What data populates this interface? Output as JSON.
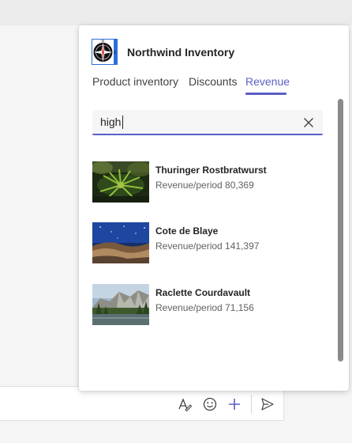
{
  "app": {
    "name": "Northwind Inventory",
    "logo_icon": "compass-logo-icon"
  },
  "tabs": [
    {
      "label": "Product inventory",
      "active": false
    },
    {
      "label": "Discounts",
      "active": false
    },
    {
      "label": "Revenue",
      "active": true
    }
  ],
  "search": {
    "value": "high",
    "clear_icon": "close-icon"
  },
  "results": [
    {
      "title": "Thuringer Rostbratwurst",
      "subtitle": "Revenue/period 80,369",
      "image": "forest-plant-photo"
    },
    {
      "title": "Cote de Blaye",
      "subtitle": "Revenue/period 141,397",
      "image": "starry-night-rocks-photo"
    },
    {
      "title": "Raclette Courdavault",
      "subtitle": "Revenue/period 71,156",
      "image": "mountain-lake-photo"
    }
  ],
  "compose_toolbar": {
    "icons": [
      "format-icon",
      "emoji-icon",
      "add-icon",
      "send-icon"
    ]
  },
  "colors": {
    "accent": "#5b5fc7"
  }
}
